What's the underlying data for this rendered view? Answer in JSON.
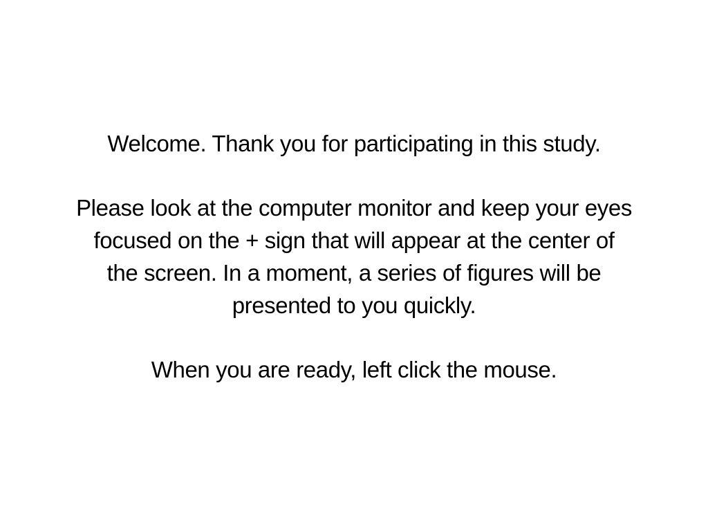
{
  "instructions": {
    "welcome": "Welcome. Thank you for participating in this study.",
    "body_lines": [
      "Please look at the computer monitor and keep your eyes",
      "focused on the + sign that will appear at the center of",
      "the screen. In a moment, a series of figures will be",
      "presented to you quickly."
    ],
    "prompt": "When you are ready, left click the mouse."
  },
  "colors": {
    "background": "#ffffff",
    "text": "#000000"
  }
}
